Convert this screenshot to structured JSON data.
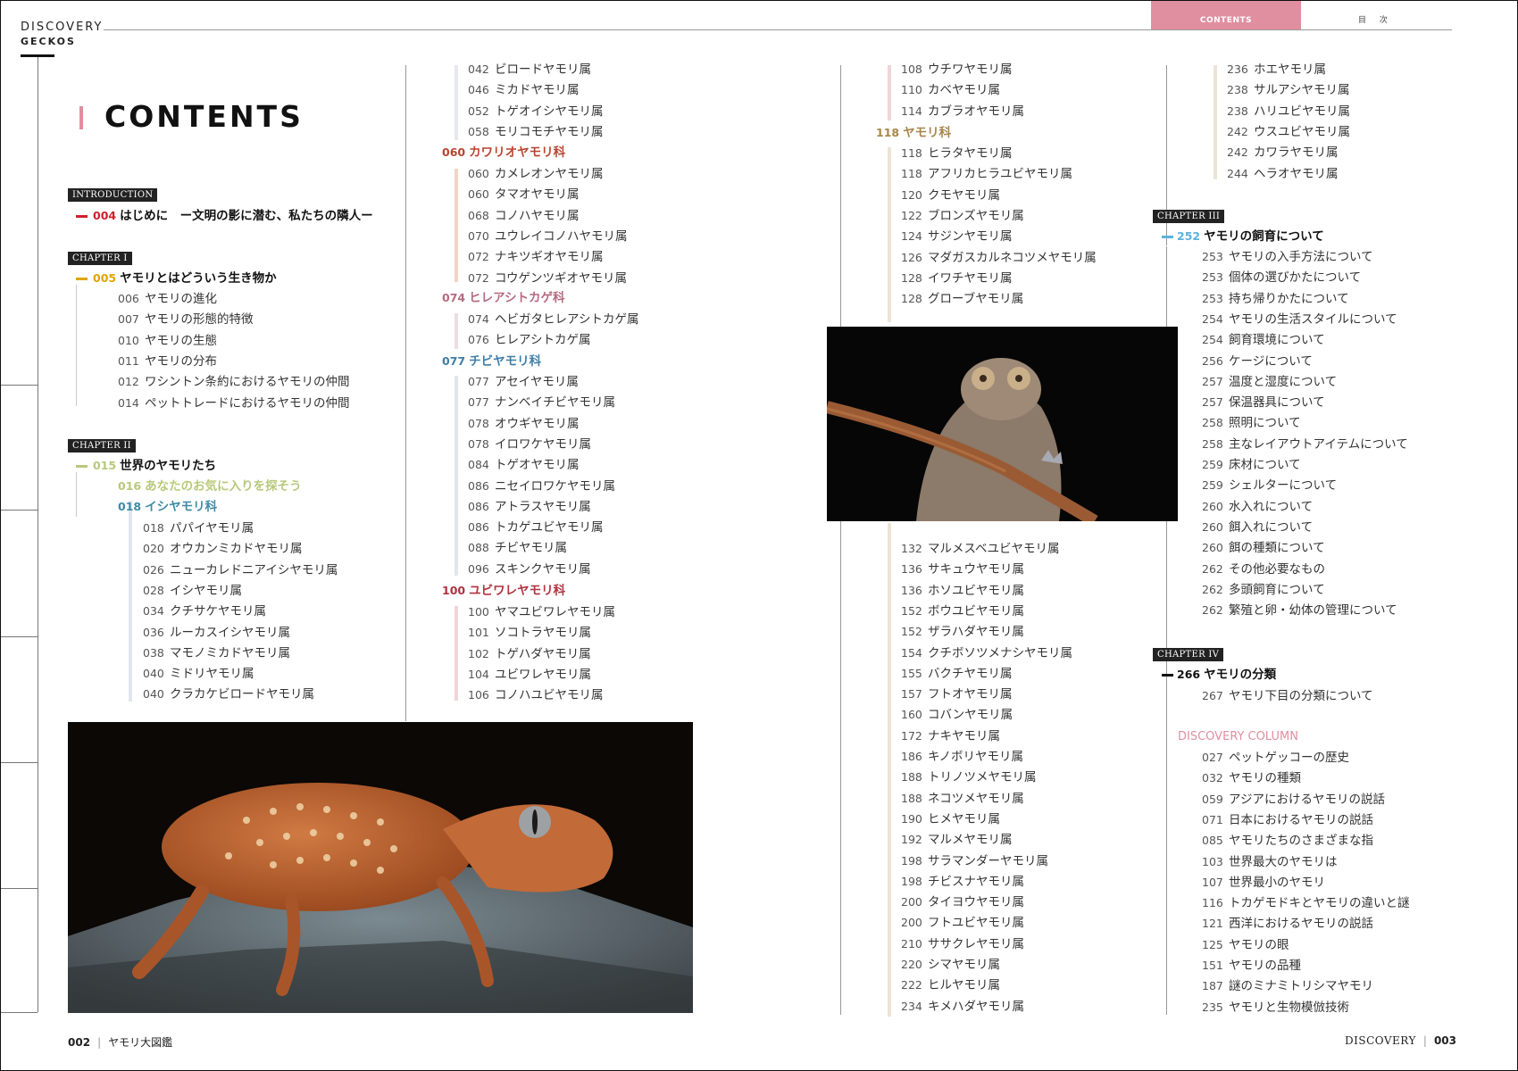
{
  "header": {
    "brand_line1": "DISCOVERY",
    "brand_line2": "GECKOS",
    "tab_contents": "CONTENTS",
    "tab_mokuji": "目 次"
  },
  "title": "CONTENTS",
  "colors": {
    "intro": "#d0202a",
    "ch1": "#e0a400",
    "ch2": "#b7c97a",
    "ch3": "#5ab3dd",
    "ch4": "#111111",
    "teal": "#3e8aa5",
    "pink": "#e08fa0",
    "brown": "#b8452f",
    "mauve": "#b56a80",
    "blue": "#3f7ea8",
    "crimson": "#b0333f",
    "gold": "#a8864a"
  },
  "col1": {
    "intro_badge": "INTRODUCTION",
    "intro": {
      "pg": "004",
      "text": "はじめに　ー文明の影に潜む、私たちの隣人ー"
    },
    "ch1_badge": "CHAPTER I",
    "ch1": {
      "pg": "005",
      "text": "ヤモリとはどういう生き物か"
    },
    "ch1_items": [
      {
        "pg": "006",
        "text": "ヤモリの進化"
      },
      {
        "pg": "007",
        "text": "ヤモリの形態的特徴"
      },
      {
        "pg": "010",
        "text": "ヤモリの生態"
      },
      {
        "pg": "011",
        "text": "ヤモリの分布"
      },
      {
        "pg": "012",
        "text": "ワシントン条約におけるヤモリの仲間"
      },
      {
        "pg": "014",
        "text": "ペットトレードにおけるヤモリの仲間"
      }
    ],
    "ch2_badge": "CHAPTER II",
    "ch2": {
      "pg": "015",
      "text": "世界のヤモリたち"
    },
    "ch2_sub": {
      "pg": "016",
      "text": "あなたのお気に入りを探そう"
    },
    "family1": {
      "pg": "018",
      "text": "イシヤモリ科"
    },
    "family1_items": [
      {
        "pg": "018",
        "text": "パパイヤモリ属"
      },
      {
        "pg": "020",
        "text": "オウカンミカドヤモリ属"
      },
      {
        "pg": "026",
        "text": "ニューカレドニアイシヤモリ属"
      },
      {
        "pg": "028",
        "text": "イシヤモリ属"
      },
      {
        "pg": "034",
        "text": "クチサケヤモリ属"
      },
      {
        "pg": "036",
        "text": "ルーカスイシヤモリ属"
      },
      {
        "pg": "038",
        "text": "マモノミカドヤモリ属"
      },
      {
        "pg": "040",
        "text": "ミドリヤモリ属"
      },
      {
        "pg": "040",
        "text": "クラカケビロードヤモリ属"
      }
    ]
  },
  "col2": {
    "top_items": [
      {
        "pg": "042",
        "text": "ビロードヤモリ属"
      },
      {
        "pg": "046",
        "text": "ミカドヤモリ属"
      },
      {
        "pg": "052",
        "text": "トゲオイシヤモリ属"
      },
      {
        "pg": "058",
        "text": "モリコモチヤモリ属"
      }
    ],
    "family2": {
      "pg": "060",
      "text": "カワリオヤモリ科"
    },
    "family2_items": [
      {
        "pg": "060",
        "text": "カメレオンヤモリ属"
      },
      {
        "pg": "060",
        "text": "タマオヤモリ属"
      },
      {
        "pg": "068",
        "text": "コノハヤモリ属"
      },
      {
        "pg": "070",
        "text": "ユウレイコノハヤモリ属"
      },
      {
        "pg": "072",
        "text": "ナキツギオヤモリ属"
      },
      {
        "pg": "072",
        "text": "コウゲンツギオヤモリ属"
      }
    ],
    "family3": {
      "pg": "074",
      "text": "ヒレアシトカゲ科"
    },
    "family3_items": [
      {
        "pg": "074",
        "text": "ヘビガタヒレアシトカゲ属"
      },
      {
        "pg": "076",
        "text": "ヒレアシトカゲ属"
      }
    ],
    "family4": {
      "pg": "077",
      "text": "チビヤモリ科"
    },
    "family4_items": [
      {
        "pg": "077",
        "text": "アセイヤモリ属"
      },
      {
        "pg": "077",
        "text": "ナンベイチビヤモリ属"
      },
      {
        "pg": "078",
        "text": "オウギヤモリ属"
      },
      {
        "pg": "078",
        "text": "イロワケヤモリ属"
      },
      {
        "pg": "084",
        "text": "トゲオヤモリ属"
      },
      {
        "pg": "086",
        "text": "ニセイロワケヤモリ属"
      },
      {
        "pg": "086",
        "text": "アトラスヤモリ属"
      },
      {
        "pg": "086",
        "text": "トカゲユビヤモリ属"
      },
      {
        "pg": "088",
        "text": "チビヤモリ属"
      },
      {
        "pg": "096",
        "text": "スキンクヤモリ属"
      }
    ],
    "family5": {
      "pg": "100",
      "text": "ユビワレヤモリ科"
    },
    "family5_items": [
      {
        "pg": "100",
        "text": "ヤマユビワレヤモリ属"
      },
      {
        "pg": "101",
        "text": "ソコトラヤモリ属"
      },
      {
        "pg": "102",
        "text": "トゲハダヤモリ属"
      },
      {
        "pg": "104",
        "text": "ユビワレヤモリ属"
      },
      {
        "pg": "106",
        "text": "コノハユビヤモリ属"
      }
    ]
  },
  "col3": {
    "top_items": [
      {
        "pg": "108",
        "text": "ウチワヤモリ属"
      },
      {
        "pg": "110",
        "text": "カベヤモリ属"
      },
      {
        "pg": "114",
        "text": "カブラオヤモリ属"
      }
    ],
    "family6": {
      "pg": "118",
      "text": "ヤモリ科"
    },
    "family6_items": [
      {
        "pg": "118",
        "text": "ヒラタヤモリ属"
      },
      {
        "pg": "118",
        "text": "アフリカヒラユビヤモリ属"
      },
      {
        "pg": "120",
        "text": "クモヤモリ属"
      },
      {
        "pg": "122",
        "text": "ブロンズヤモリ属"
      },
      {
        "pg": "124",
        "text": "サジンヤモリ属"
      },
      {
        "pg": "126",
        "text": "マダガスカルネコツメヤモリ属"
      },
      {
        "pg": "128",
        "text": "イワチヤモリ属"
      },
      {
        "pg": "128",
        "text": "グローブヤモリ属"
      }
    ],
    "bottom_items": [
      {
        "pg": "132",
        "text": "マルメスベユビヤモリ属"
      },
      {
        "pg": "136",
        "text": "サキュウヤモリ属"
      },
      {
        "pg": "136",
        "text": "ホソユビヤモリ属"
      },
      {
        "pg": "152",
        "text": "ボウユビヤモリ属"
      },
      {
        "pg": "152",
        "text": "ザラハダヤモリ属"
      },
      {
        "pg": "154",
        "text": "クチボソツメナシヤモリ属"
      },
      {
        "pg": "155",
        "text": "バクチヤモリ属"
      },
      {
        "pg": "157",
        "text": "フトオヤモリ属"
      },
      {
        "pg": "160",
        "text": "コバンヤモリ属"
      },
      {
        "pg": "172",
        "text": "ナキヤモリ属"
      },
      {
        "pg": "186",
        "text": "キノボリヤモリ属"
      },
      {
        "pg": "188",
        "text": "トリノツメヤモリ属"
      },
      {
        "pg": "188",
        "text": "ネコツメヤモリ属"
      },
      {
        "pg": "190",
        "text": "ヒメヤモリ属"
      },
      {
        "pg": "192",
        "text": "マルメヤモリ属"
      },
      {
        "pg": "198",
        "text": "サラマンダーヤモリ属"
      },
      {
        "pg": "198",
        "text": "チビスナヤモリ属"
      },
      {
        "pg": "200",
        "text": "タイヨウヤモリ属"
      },
      {
        "pg": "200",
        "text": "フトユビヤモリ属"
      },
      {
        "pg": "210",
        "text": "ササクレヤモリ属"
      },
      {
        "pg": "220",
        "text": "シマヤモリ属"
      },
      {
        "pg": "222",
        "text": "ヒルヤモリ属"
      },
      {
        "pg": "234",
        "text": "キメハダヤモリ属"
      }
    ]
  },
  "col4": {
    "top_items": [
      {
        "pg": "236",
        "text": "ホエヤモリ属"
      },
      {
        "pg": "238",
        "text": "サルアシヤモリ属"
      },
      {
        "pg": "238",
        "text": "ハリユビヤモリ属"
      },
      {
        "pg": "242",
        "text": "ウスユビヤモリ属"
      },
      {
        "pg": "242",
        "text": "カワラヤモリ属"
      },
      {
        "pg": "244",
        "text": "ヘラオヤモリ属"
      }
    ],
    "ch3_badge": "CHAPTER III",
    "ch3": {
      "pg": "252",
      "text": "ヤモリの飼育について"
    },
    "ch3_items": [
      {
        "pg": "253",
        "text": "ヤモリの入手方法について"
      },
      {
        "pg": "253",
        "text": "個体の選びかたについて"
      },
      {
        "pg": "253",
        "text": "持ち帰りかたについて"
      },
      {
        "pg": "254",
        "text": "ヤモリの生活スタイルについて"
      },
      {
        "pg": "254",
        "text": "飼育環境について"
      },
      {
        "pg": "256",
        "text": "ケージについて"
      },
      {
        "pg": "257",
        "text": "温度と湿度について"
      },
      {
        "pg": "257",
        "text": "保温器具について"
      },
      {
        "pg": "258",
        "text": "照明について"
      },
      {
        "pg": "258",
        "text": "主なレイアウトアイテムについて"
      },
      {
        "pg": "259",
        "text": "床材について"
      },
      {
        "pg": "259",
        "text": "シェルターについて"
      },
      {
        "pg": "260",
        "text": "水入れについて"
      },
      {
        "pg": "260",
        "text": "餌入れについて"
      },
      {
        "pg": "260",
        "text": "餌の種類について"
      },
      {
        "pg": "262",
        "text": "その他必要なもの"
      },
      {
        "pg": "262",
        "text": "多頭飼育について"
      },
      {
        "pg": "262",
        "text": "繁殖と卵・幼体の管理について"
      }
    ],
    "ch4_badge": "CHAPTER IV",
    "ch4": {
      "pg": "266",
      "text": "ヤモリの分類"
    },
    "ch4_items": [
      {
        "pg": "267",
        "text": "ヤモリ下目の分類について"
      }
    ],
    "column_heading": "DISCOVERY COLUMN",
    "column_items": [
      {
        "pg": "027",
        "text": "ペットゲッコーの歴史"
      },
      {
        "pg": "032",
        "text": "ヤモリの種類"
      },
      {
        "pg": "059",
        "text": "アジアにおけるヤモリの説話"
      },
      {
        "pg": "071",
        "text": "日本におけるヤモリの説話"
      },
      {
        "pg": "085",
        "text": "ヤモリたちのさまざまな指"
      },
      {
        "pg": "103",
        "text": "世界最大のヤモリは"
      },
      {
        "pg": "107",
        "text": "世界最小のヤモリ"
      },
      {
        "pg": "116",
        "text": "トカゲモドキとヤモリの違いと謎"
      },
      {
        "pg": "121",
        "text": "西洋におけるヤモリの説話"
      },
      {
        "pg": "125",
        "text": "ヤモリの眼"
      },
      {
        "pg": "151",
        "text": "ヤモリの品種"
      },
      {
        "pg": "187",
        "text": "謎のミナミトリシマヤモリ"
      },
      {
        "pg": "235",
        "text": "ヤモリと生物模倣技術"
      }
    ]
  },
  "footer": {
    "left_num": "002",
    "left_text": "ヤモリ大図鑑",
    "right_text": "DISCOVERY",
    "right_num": "003"
  }
}
